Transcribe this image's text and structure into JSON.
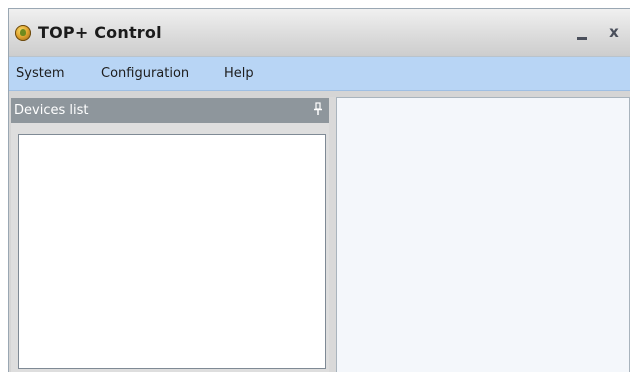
{
  "window": {
    "title": "TOP+ Control",
    "minimize_glyph": "_",
    "close_glyph": "x",
    "icon": "app-logo-icon"
  },
  "menu": {
    "items": [
      {
        "label": "System"
      },
      {
        "label": "Configuration"
      },
      {
        "label": "Help"
      }
    ]
  },
  "devices_panel": {
    "title": "Devices list",
    "pin_icon": "pin-icon",
    "items": []
  },
  "colors": {
    "menubar_bg": "#b8d5f5",
    "panel_header_bg": "#8e969c"
  }
}
